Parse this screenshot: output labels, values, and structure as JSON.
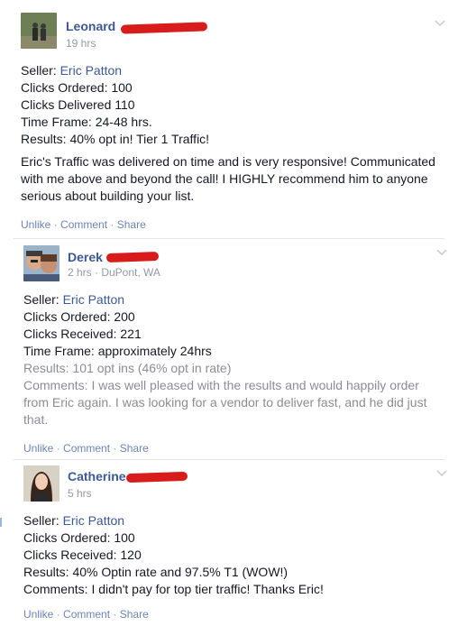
{
  "posts": [
    {
      "name": "Leonard",
      "time": "19 hrs",
      "lines": [
        {
          "label": "Seller: ",
          "value": "Eric Patton"
        },
        {
          "label": "Clicks Ordered: ",
          "value": "100"
        },
        {
          "label": "Clicks Delivered ",
          "value": "110"
        },
        {
          "label": "Time Frame: ",
          "value": "24-48 hrs."
        },
        {
          "label": "Results: ",
          "value": "40% opt in! Tier 1 Traffic!"
        }
      ],
      "paragraph": "Eric's Traffic was delivered on time and is very responsive! Communicated with me above and beyond the call! I HIGHLY recommend him to anyone serious about building your list.",
      "actions": {
        "unlike": "Unlike",
        "comment": "Comment",
        "share": "Share",
        "sep": "·"
      }
    },
    {
      "name": "Derek",
      "time": "2 hrs · DuPont, WA",
      "lines": [
        {
          "label": "Seller: ",
          "value": "Eric Patton"
        },
        {
          "label": "Clicks Ordered: ",
          "value": "200"
        },
        {
          "label": "Clicks Received: ",
          "value": "221"
        },
        {
          "label": "Time Frame: ",
          "value": "approximately 24hrs"
        },
        {
          "label": "Results: ",
          "value": "101 opt ins (46% opt in rate)"
        }
      ],
      "paragraph": "Comments: I was well pleased with the results and would happily order from Eric again. I was looking for a vendor to deliver fast, and he did just that.",
      "actions": {
        "unlike": "Unlike",
        "comment": "Comment",
        "share": "Share",
        "sep": "·"
      }
    },
    {
      "name": "Catherine",
      "time": "5 hrs",
      "lines": [
        {
          "label": "Seller: ",
          "value": "Eric Patton"
        },
        {
          "label": "Clicks Ordered: ",
          "value": "100"
        },
        {
          "label": "Clicks Received: ",
          "value": "120"
        },
        {
          "label": "Results: ",
          "value": "40% Optin rate and 97.5% T1 (WOW!)"
        },
        {
          "label": "Comments: ",
          "value": "I didn't pay for top tier traffic! Thanks Eric!"
        }
      ],
      "actions": {
        "unlike": "Unlike",
        "comment": "Comment",
        "share": "Share",
        "sep": "·"
      }
    }
  ],
  "colors": {
    "link": "#3b5998",
    "redaction": "#d81c1c",
    "meta": "#9197a3"
  }
}
